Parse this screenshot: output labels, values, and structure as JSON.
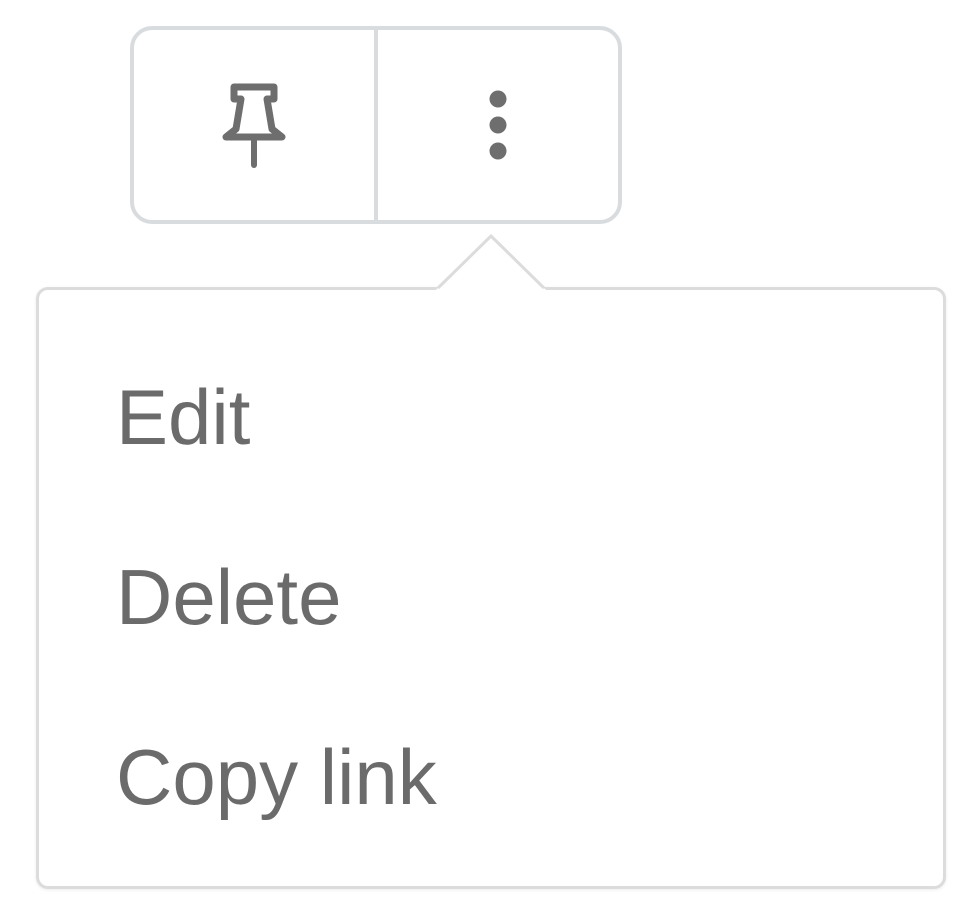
{
  "toolbar": {
    "pin_icon": "pushpin-icon",
    "more_icon": "vertical-ellipsis-icon"
  },
  "menu": {
    "items": [
      {
        "label": "Edit"
      },
      {
        "label": "Delete"
      },
      {
        "label": "Copy link"
      }
    ]
  },
  "colors": {
    "border": "#d9dcdf",
    "icon": "#6e6e6e",
    "text": "#6b6b6b"
  }
}
